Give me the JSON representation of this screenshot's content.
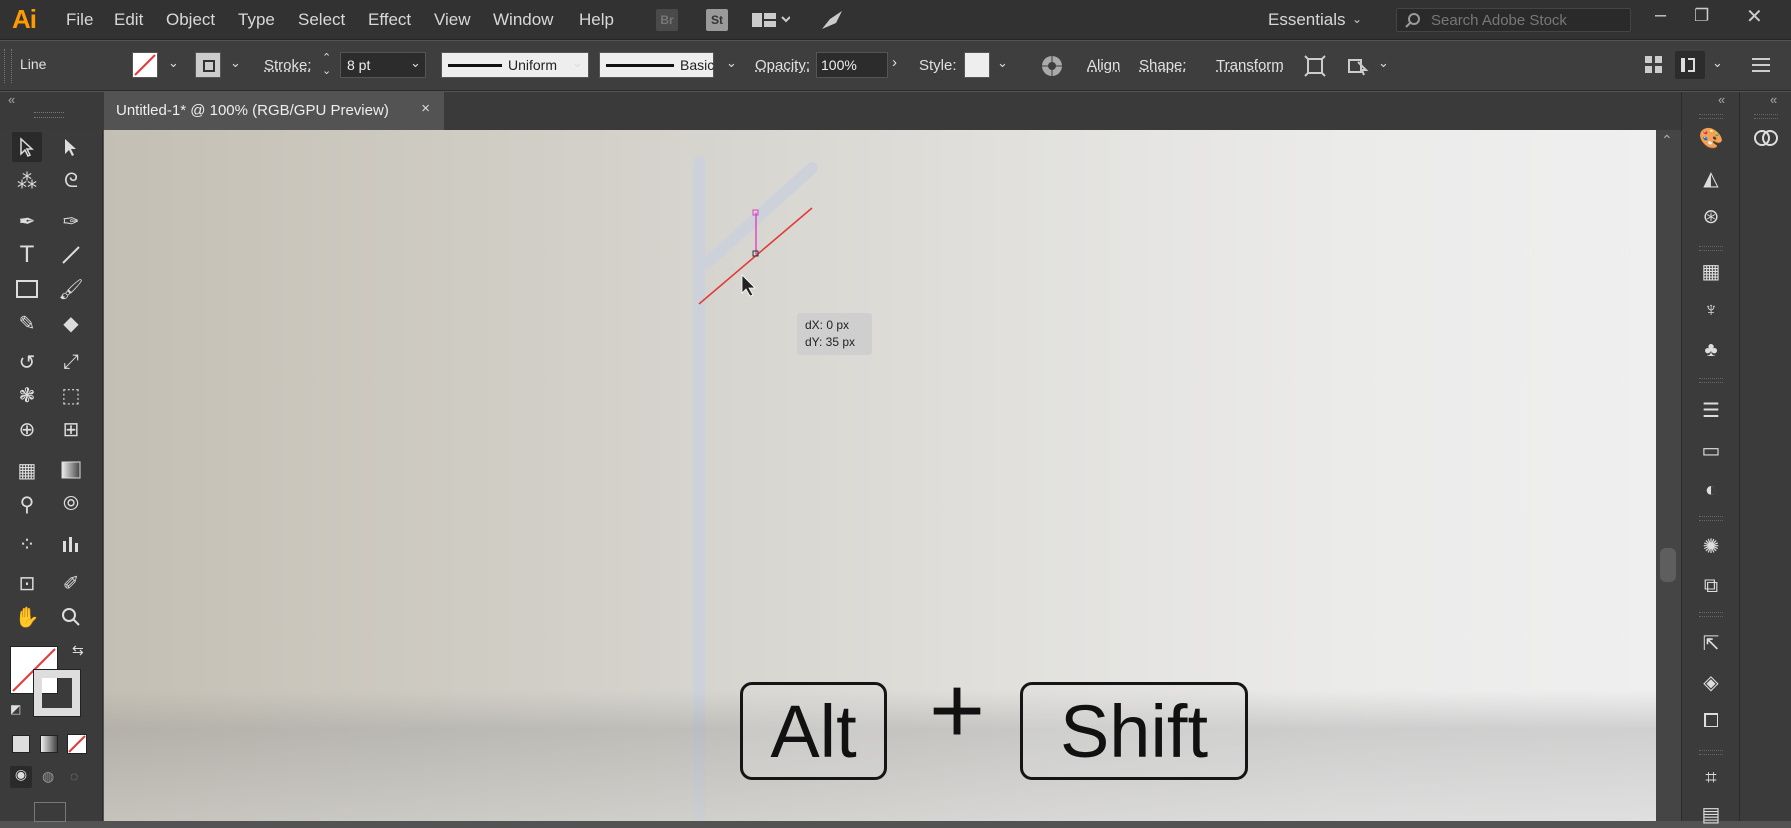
{
  "app": {
    "logo": "Ai"
  },
  "menu": [
    "File",
    "Edit",
    "Object",
    "Type",
    "Select",
    "Effect",
    "View",
    "Window",
    "Help"
  ],
  "menubar_icons": {
    "bridge": "Br",
    "stock": "St"
  },
  "workspace": {
    "label": "Essentials"
  },
  "search": {
    "placeholder": "Search Adobe Stock"
  },
  "control_bar": {
    "selection_type": "Line",
    "stroke_label": "Stroke:",
    "stroke_value": "8 pt",
    "profile_label": "Uniform",
    "brush_label": "Basic",
    "opacity_label": "Opacity:",
    "opacity_value": "100%",
    "style_label": "Style:",
    "align_label": "Align",
    "shape_label": "Shape:",
    "transform_label": "Transform"
  },
  "document_tab": {
    "title": "Untitled-1* @ 100% (RGB/GPU Preview)",
    "close": "×"
  },
  "canvas": {
    "readout_dx": "dX: 0 px",
    "readout_dy": "dY: 35 px",
    "key1": "Alt",
    "plus": "+",
    "key2": "Shift"
  },
  "colors": {
    "accent": "#ff9a00",
    "stroke_preview": "#e23b3b",
    "path_guide": "#e040c0"
  },
  "tools": [
    "selection-tool",
    "direct-selection-tool",
    "magic-wand-tool",
    "lasso-tool",
    "pen-tool",
    "curvature-tool",
    "type-tool",
    "line-segment-tool",
    "rectangle-tool",
    "paintbrush-tool",
    "shaper-tool",
    "eraser-tool",
    "rotate-tool",
    "scale-tool",
    "warp-tool",
    "free-transform-tool",
    "shape-builder-tool",
    "perspective-grid-tool",
    "mesh-tool",
    "gradient-tool",
    "eyedropper-tool",
    "blend-tool",
    "symbol-sprayer-tool",
    "column-graph-tool",
    "artboard-tool",
    "slice-tool",
    "hand-tool",
    "zoom-tool"
  ]
}
